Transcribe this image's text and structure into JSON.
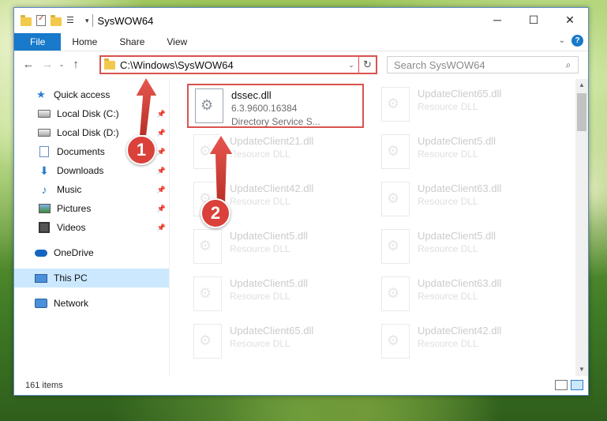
{
  "window": {
    "title": "SysWOW64",
    "controls": {
      "minimize": "─",
      "maximize": "☐",
      "close": "✕"
    }
  },
  "ribbon": {
    "tabs": [
      "File",
      "Home",
      "Share",
      "View"
    ],
    "collapse_glyph": "⌄",
    "help_glyph": "?"
  },
  "nav": {
    "back_glyph": "←",
    "forward_glyph": "→",
    "recent_glyph": "⌄",
    "up_glyph": "↑",
    "address": "C:\\Windows\\SysWOW64",
    "address_dropdown_glyph": "⌄",
    "refresh_glyph": "↻",
    "search_placeholder": "Search SysWOW64",
    "search_glyph": "⌕"
  },
  "sidebar": {
    "items": [
      {
        "label": "Quick access",
        "icon": "star-icon",
        "pinned": false
      },
      {
        "label": "Local Disk (C:)",
        "icon": "drive-icon",
        "pinned": true
      },
      {
        "label": "Local Disk (D:)",
        "icon": "drive-icon",
        "pinned": true
      },
      {
        "label": "Documents",
        "icon": "document-icon",
        "pinned": true
      },
      {
        "label": "Downloads",
        "icon": "download-icon",
        "pinned": true
      },
      {
        "label": "Music",
        "icon": "music-icon",
        "pinned": true
      },
      {
        "label": "Pictures",
        "icon": "pictures-icon",
        "pinned": true
      },
      {
        "label": "Videos",
        "icon": "videos-icon",
        "pinned": true
      },
      {
        "label": "OneDrive",
        "icon": "onedrive-icon"
      },
      {
        "label": "This PC",
        "icon": "computer-icon",
        "selected": true
      },
      {
        "label": "Network",
        "icon": "network-icon"
      }
    ],
    "pin_glyph": "📌"
  },
  "files": {
    "highlighted": {
      "name": "dssec.dll",
      "version": "6.3.9600.16384",
      "description": "Directory Service S..."
    },
    "left_column": [
      {
        "name": "UpdateClient21.dll",
        "type": "Resource DLL"
      },
      {
        "name": "UpdateClient42.dll",
        "type": "Resource DLL"
      },
      {
        "name": "UpdateClient5.dll",
        "type": "Resource DLL"
      },
      {
        "name": "UpdateClient5.dll",
        "type": "Resource DLL"
      },
      {
        "name": "UpdateClient65.dll",
        "type": "Resource DLL"
      }
    ],
    "right_column": [
      {
        "name": "UpdateClient65.dll",
        "type": "Resource DLL"
      },
      {
        "name": "UpdateClient5.dll",
        "type": "Resource DLL"
      },
      {
        "name": "UpdateClient63.dll",
        "type": "Resource DLL"
      },
      {
        "name": "UpdateClient5.dll",
        "type": "Resource DLL"
      },
      {
        "name": "UpdateClient63.dll",
        "type": "Resource DLL"
      },
      {
        "name": "UpdateClient42.dll",
        "type": "Resource DLL"
      }
    ]
  },
  "status": {
    "count": "161 items"
  },
  "annotations": {
    "step1": "1",
    "step2": "2",
    "color": "#d9413a"
  }
}
